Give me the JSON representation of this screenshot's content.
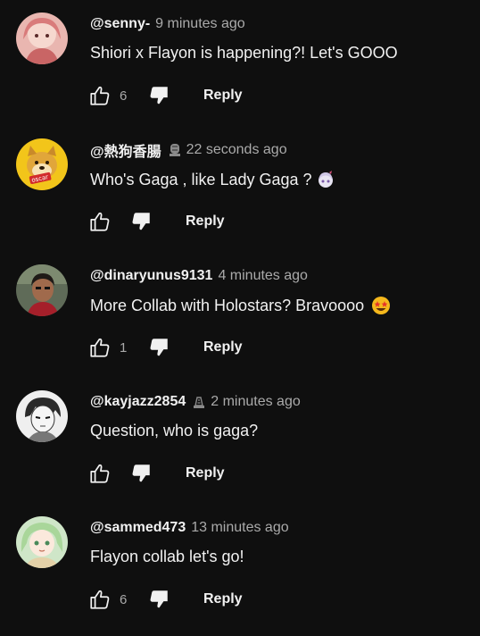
{
  "comments": [
    {
      "author": "@senny-",
      "time": "9 minutes ago",
      "text": "Shiori x Flayon is happening?! Let's GOOO",
      "likes": "6",
      "reply_label": "Reply",
      "avatar_icon": "avatar-pink-anime-icon"
    },
    {
      "author": "@熱狗香腸",
      "badge_icon": "member-badge-icon",
      "time": "22 seconds ago",
      "text": "Who's Gaga , like Lady Gaga ?",
      "emoji_icon": "anime-girl-emote-icon",
      "likes": "",
      "reply_label": "Reply",
      "avatar_icon": "avatar-doge-icon",
      "avatar_text": "oscar"
    },
    {
      "author": "@dinaryunus9131",
      "time": "4 minutes ago",
      "text": "More Collab with Holostars? Bravoooo",
      "emoji_icon": "star-struck-emoji-icon",
      "likes": "1",
      "reply_label": "Reply",
      "avatar_icon": "avatar-photo-icon"
    },
    {
      "author": "@kayjazz2854",
      "badge_icon": "member-badge-icon",
      "time": "2 minutes ago",
      "text": "Question, who is gaga?",
      "likes": "",
      "reply_label": "Reply",
      "avatar_icon": "avatar-manga-icon"
    },
    {
      "author": "@sammed473",
      "time": "13 minutes ago",
      "text": "Flayon collab let's go!",
      "likes": "6",
      "reply_label": "Reply",
      "avatar_icon": "avatar-green-anime-icon"
    }
  ],
  "colors": {
    "background": "#0f0f0f",
    "text_primary": "#f1f1f1",
    "text_secondary": "#aaaaaa"
  }
}
